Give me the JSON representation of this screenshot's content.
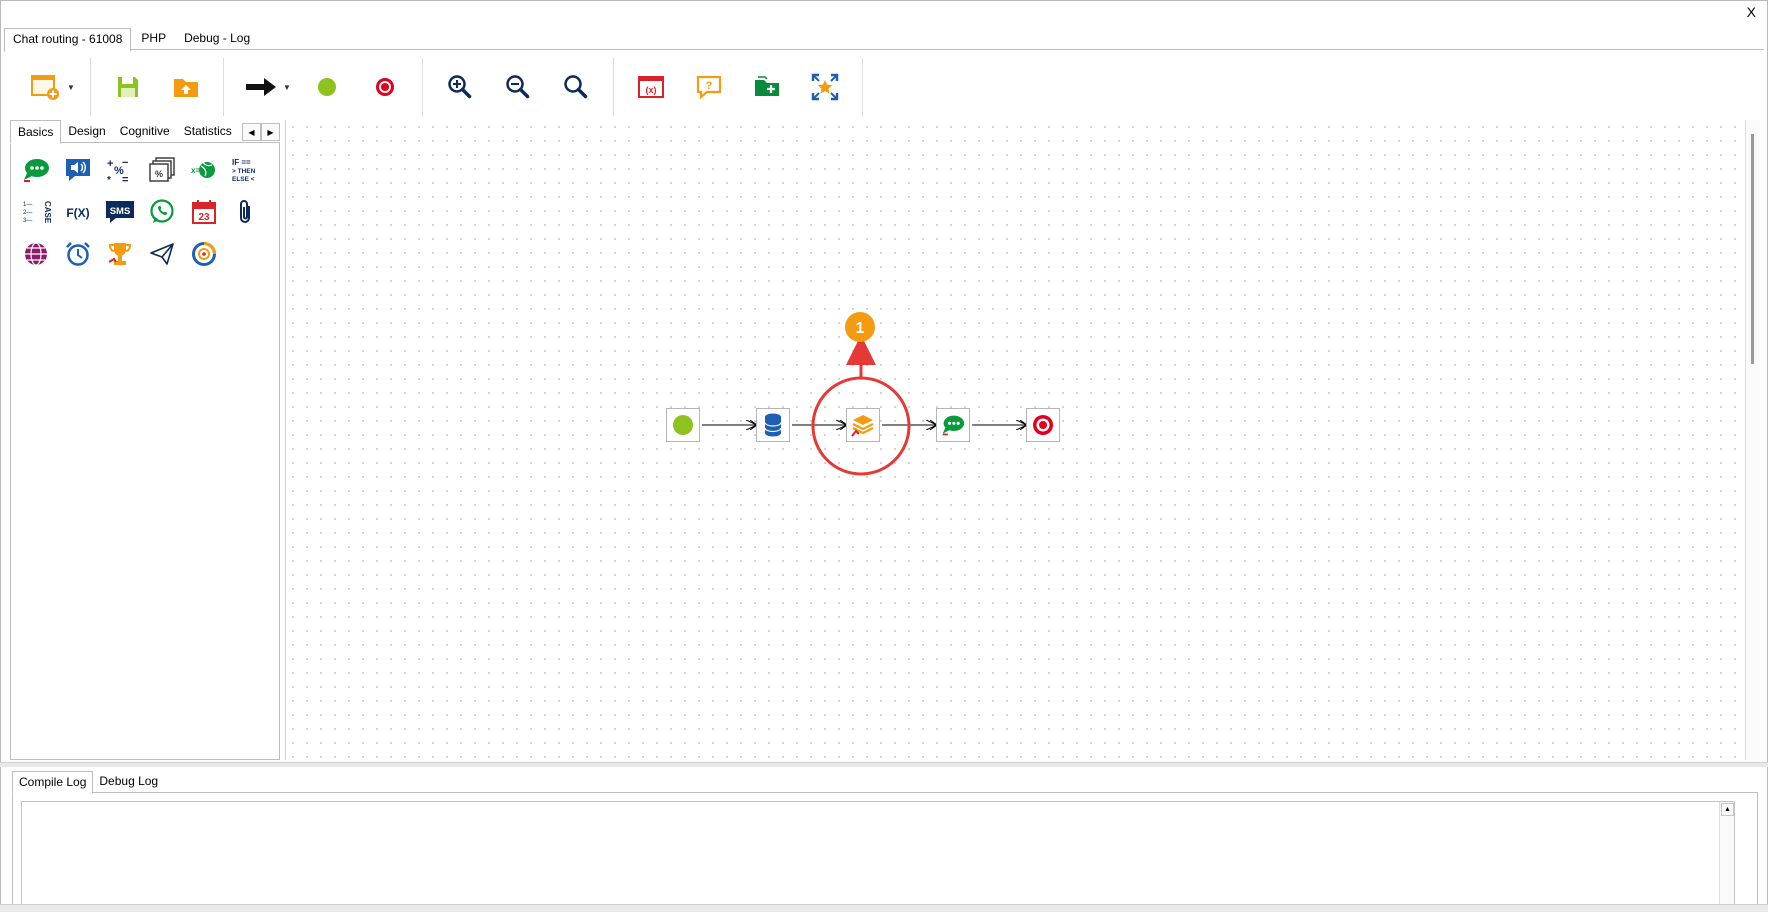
{
  "window": {
    "close_label": "X"
  },
  "top_tabs": [
    {
      "label": "Chat routing - 61008"
    },
    {
      "label": "PHP"
    },
    {
      "label": "Debug - Log"
    }
  ],
  "toolbar": {
    "groups": [
      [
        "new-flow-icon",
        "dropdown"
      ],
      [
        "save-icon",
        "open-folder-icon"
      ],
      [
        "arrow-connector-icon",
        "dropdown",
        "start-node-icon",
        "end-node-icon"
      ],
      [
        "zoom-in-icon",
        "zoom-out-icon",
        "zoom-reset-icon"
      ],
      [
        "variables-icon",
        "help-question-icon",
        "add-folder-icon",
        "fit-view-icon"
      ]
    ]
  },
  "left_tabs": [
    {
      "label": "Basics"
    },
    {
      "label": "Design"
    },
    {
      "label": "Cognitive"
    },
    {
      "label": "Statistics"
    }
  ],
  "palette": {
    "items": [
      {
        "icon": "chat-message-icon"
      },
      {
        "icon": "speaker-announcement-icon"
      },
      {
        "icon": "math-operators-icon",
        "text": "+-%×="
      },
      {
        "icon": "percent-windows-icon"
      },
      {
        "icon": "web-service-icon"
      },
      {
        "icon": "if-then-else-icon",
        "text": "IF == THEN ELSE <"
      },
      {
        "icon": "case-list-icon",
        "text": "CASE"
      },
      {
        "icon": "function-icon",
        "text": "F(X)"
      },
      {
        "icon": "sms-icon",
        "text": "SMS"
      },
      {
        "icon": "whatsapp-icon"
      },
      {
        "icon": "calendar-icon",
        "text": "23"
      },
      {
        "icon": "paperclip-icon"
      },
      {
        "icon": "globe-icon"
      },
      {
        "icon": "alarm-clock-icon"
      },
      {
        "icon": "trophy-icon"
      },
      {
        "icon": "paper-plane-icon"
      },
      {
        "icon": "target-ring-icon"
      }
    ]
  },
  "canvas": {
    "nodes": [
      {
        "icon": "start-node-icon"
      },
      {
        "icon": "database-icon"
      },
      {
        "icon": "layers-node-icon",
        "highlighted": true
      },
      {
        "icon": "chat-message-icon"
      },
      {
        "icon": "end-node-icon"
      }
    ],
    "callout_number": "1"
  },
  "bottom_tabs": [
    {
      "label": "Compile Log"
    },
    {
      "label": "Debug Log"
    }
  ],
  "colors": {
    "accent_orange": "#f39c12",
    "start_green": "#8dc21f",
    "end_red": "#e2001a",
    "highlight_red": "#e53935"
  }
}
